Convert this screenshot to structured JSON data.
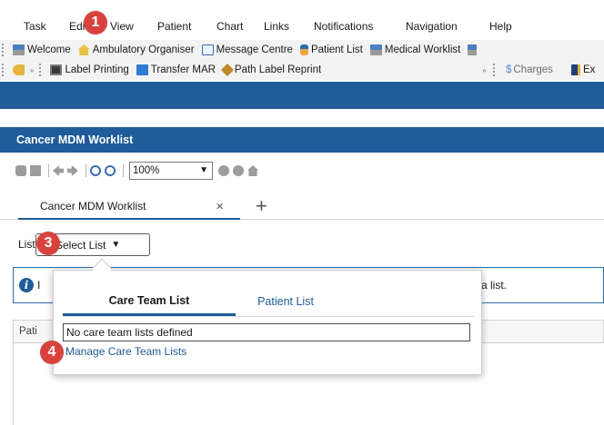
{
  "menu": [
    "Task",
    "Edit",
    "View",
    "Patient",
    "Chart",
    "Links",
    "Notifications",
    "Navigation",
    "Help"
  ],
  "toolbar1": [
    "Welcome",
    "Ambulatory Organiser",
    "Message Centre",
    "Patient List",
    "Medical Worklist"
  ],
  "toolbar2": [
    "Label Printing",
    "Transfer MAR",
    "Path Label Reprint"
  ],
  "toolbar2_right": [
    "Charges",
    "Ex"
  ],
  "title": "Cancer MDM Worklist",
  "zoom": "100%",
  "tab": {
    "label": "Cancer MDM Worklist",
    "close": "×",
    "add": "+"
  },
  "list_label": "List",
  "select_list": "Select List",
  "info": {
    "prefix": "I",
    "suffix": "a list."
  },
  "grid_header": "Pati",
  "popup": {
    "tab_care": "Care Team List",
    "tab_patient": "Patient List",
    "empty_text": "No care team lists defined",
    "manage_link": "Manage Care Team Lists"
  },
  "callouts": [
    "1",
    "3",
    "4"
  ]
}
